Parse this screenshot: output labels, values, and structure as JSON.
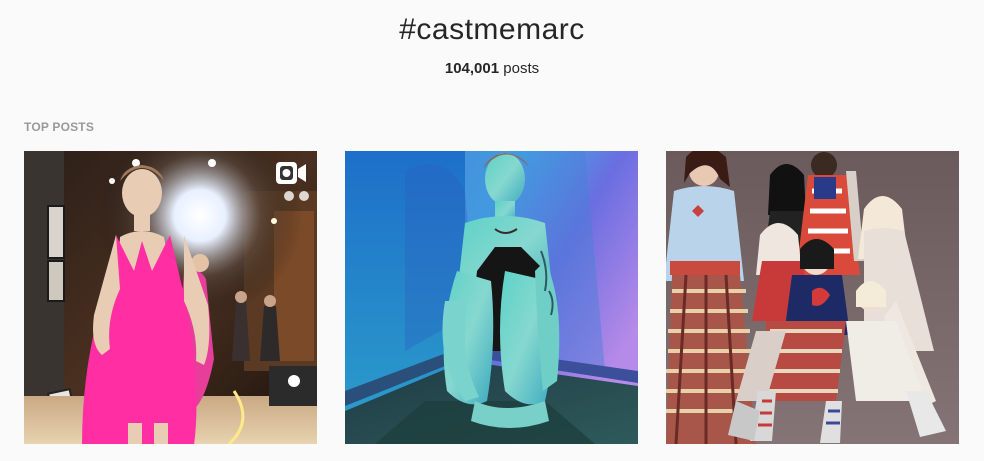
{
  "hashtag": {
    "title": "#castmemarc",
    "count_number": "104,001",
    "count_suffix": " posts"
  },
  "sections": {
    "top_posts_label": "TOP POSTS"
  },
  "posts": [
    {
      "kind": "video",
      "badge_icon": "video-camera-icon",
      "subject": "runway model in pink dress"
    },
    {
      "kind": "photo",
      "subject": "woman sitting in corner under blue and green light"
    },
    {
      "kind": "photo",
      "subject": "group of models in patterned outfits"
    }
  ],
  "colors": {
    "background": "#fafafa",
    "text": "#262626",
    "muted": "#999999"
  }
}
